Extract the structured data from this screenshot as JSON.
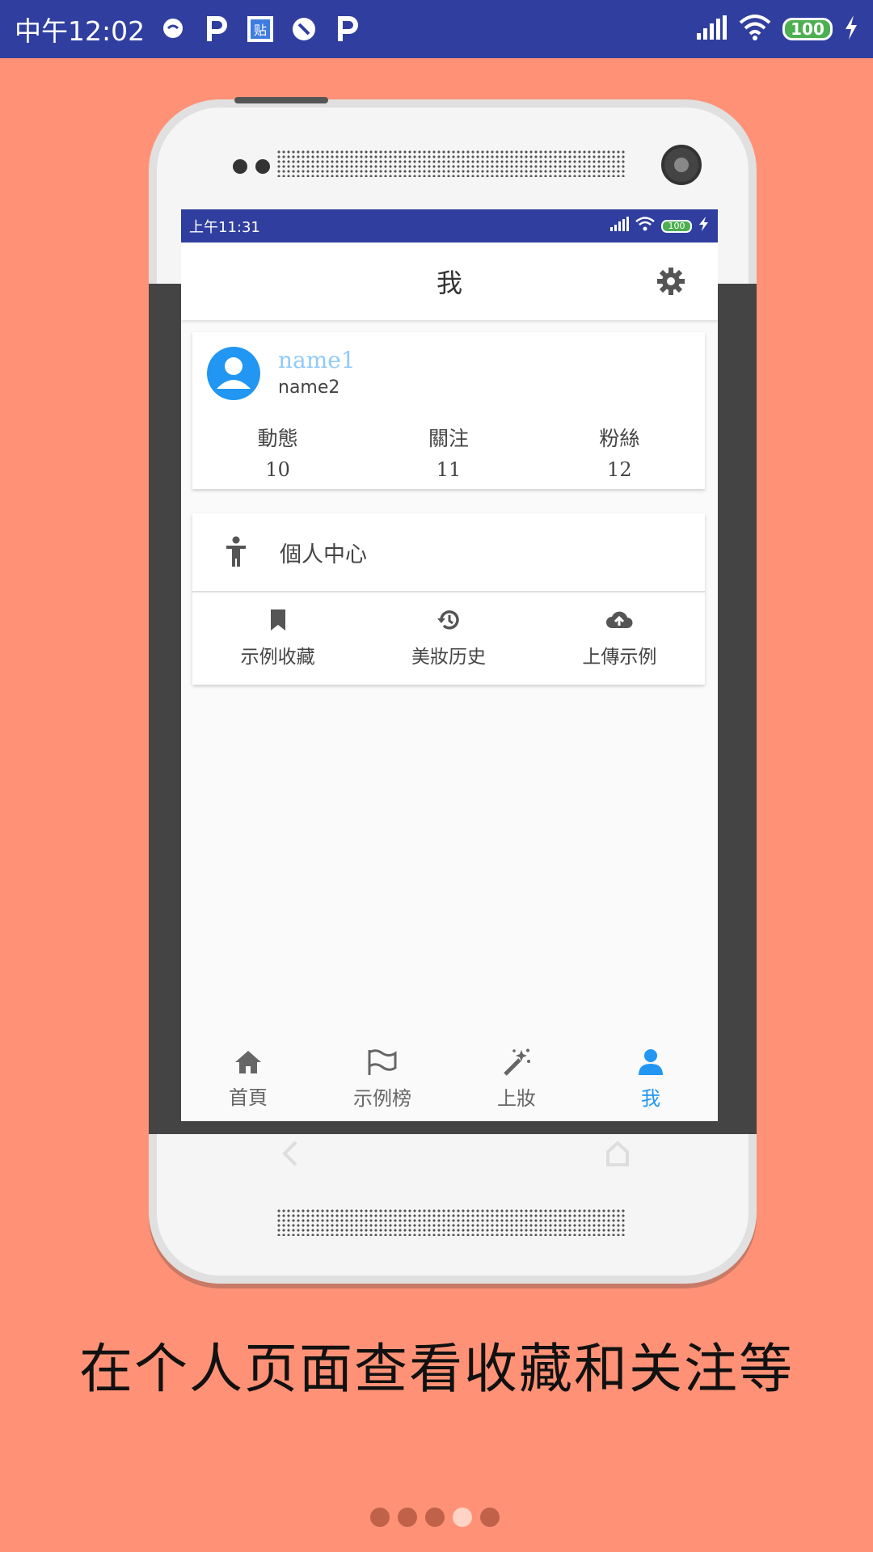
{
  "status_bar": {
    "time": "中午12:02",
    "battery": "100",
    "left_icons": [
      "chat-icon",
      "p-app-icon",
      "tieba-icon",
      "block-icon",
      "p-app-icon"
    ]
  },
  "inner_status_bar": {
    "time": "上午11:31",
    "battery": "100"
  },
  "app": {
    "title": "我",
    "profile": {
      "name1": "name1",
      "name2": "name2",
      "stats": [
        {
          "label": "動態",
          "value": "10"
        },
        {
          "label": "關注",
          "value": "11"
        },
        {
          "label": "粉絲",
          "value": "12"
        }
      ]
    },
    "center": {
      "label": "個人中心",
      "actions": [
        {
          "label": "示例收藏",
          "icon": "bookmark-icon"
        },
        {
          "label": "美妝历史",
          "icon": "history-icon"
        },
        {
          "label": "上傳示例",
          "icon": "cloud-upload-icon"
        }
      ]
    },
    "bottom_nav": [
      {
        "label": "首頁",
        "icon": "home-icon"
      },
      {
        "label": "示例榜",
        "icon": "flag-icon"
      },
      {
        "label": "上妝",
        "icon": "magic-wand-icon"
      },
      {
        "label": "我",
        "icon": "person-icon",
        "active": true
      }
    ]
  },
  "caption": "在个人页面查看收藏和关注等",
  "pager": {
    "count": 5,
    "active_index": 3
  },
  "colors": {
    "background": "#FF9276",
    "status_bar": "#303F9F",
    "accent": "#2196F3",
    "name1": "#90CAF9"
  }
}
